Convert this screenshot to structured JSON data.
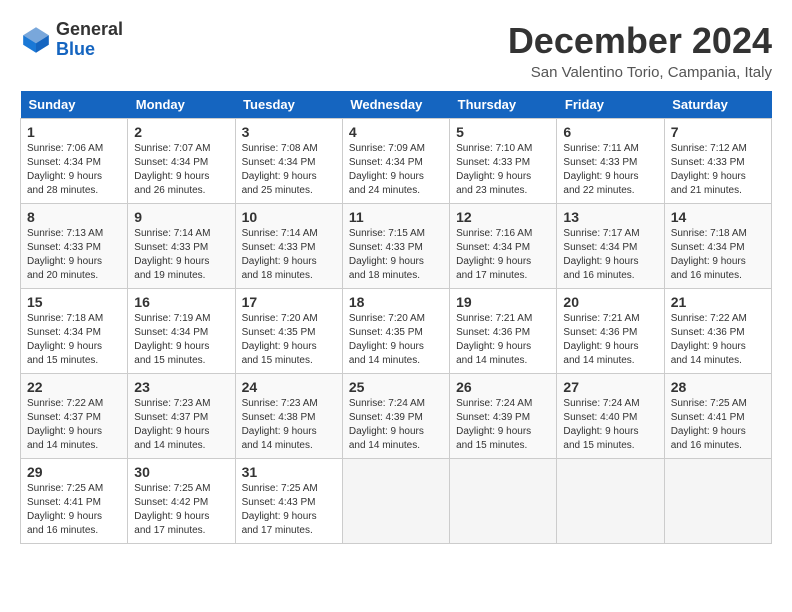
{
  "header": {
    "logo_line1": "General",
    "logo_line2": "Blue",
    "month": "December 2024",
    "location": "San Valentino Torio, Campania, Italy"
  },
  "weekdays": [
    "Sunday",
    "Monday",
    "Tuesday",
    "Wednesday",
    "Thursday",
    "Friday",
    "Saturday"
  ],
  "weeks": [
    [
      {
        "day": "1",
        "sunrise": "7:06 AM",
        "sunset": "4:34 PM",
        "daylight": "9 hours and 28 minutes."
      },
      {
        "day": "2",
        "sunrise": "7:07 AM",
        "sunset": "4:34 PM",
        "daylight": "9 hours and 26 minutes."
      },
      {
        "day": "3",
        "sunrise": "7:08 AM",
        "sunset": "4:34 PM",
        "daylight": "9 hours and 25 minutes."
      },
      {
        "day": "4",
        "sunrise": "7:09 AM",
        "sunset": "4:34 PM",
        "daylight": "9 hours and 24 minutes."
      },
      {
        "day": "5",
        "sunrise": "7:10 AM",
        "sunset": "4:33 PM",
        "daylight": "9 hours and 23 minutes."
      },
      {
        "day": "6",
        "sunrise": "7:11 AM",
        "sunset": "4:33 PM",
        "daylight": "9 hours and 22 minutes."
      },
      {
        "day": "7",
        "sunrise": "7:12 AM",
        "sunset": "4:33 PM",
        "daylight": "9 hours and 21 minutes."
      }
    ],
    [
      {
        "day": "8",
        "sunrise": "7:13 AM",
        "sunset": "4:33 PM",
        "daylight": "9 hours and 20 minutes."
      },
      {
        "day": "9",
        "sunrise": "7:14 AM",
        "sunset": "4:33 PM",
        "daylight": "9 hours and 19 minutes."
      },
      {
        "day": "10",
        "sunrise": "7:14 AM",
        "sunset": "4:33 PM",
        "daylight": "9 hours and 18 minutes."
      },
      {
        "day": "11",
        "sunrise": "7:15 AM",
        "sunset": "4:33 PM",
        "daylight": "9 hours and 18 minutes."
      },
      {
        "day": "12",
        "sunrise": "7:16 AM",
        "sunset": "4:34 PM",
        "daylight": "9 hours and 17 minutes."
      },
      {
        "day": "13",
        "sunrise": "7:17 AM",
        "sunset": "4:34 PM",
        "daylight": "9 hours and 16 minutes."
      },
      {
        "day": "14",
        "sunrise": "7:18 AM",
        "sunset": "4:34 PM",
        "daylight": "9 hours and 16 minutes."
      }
    ],
    [
      {
        "day": "15",
        "sunrise": "7:18 AM",
        "sunset": "4:34 PM",
        "daylight": "9 hours and 15 minutes."
      },
      {
        "day": "16",
        "sunrise": "7:19 AM",
        "sunset": "4:34 PM",
        "daylight": "9 hours and 15 minutes."
      },
      {
        "day": "17",
        "sunrise": "7:20 AM",
        "sunset": "4:35 PM",
        "daylight": "9 hours and 15 minutes."
      },
      {
        "day": "18",
        "sunrise": "7:20 AM",
        "sunset": "4:35 PM",
        "daylight": "9 hours and 14 minutes."
      },
      {
        "day": "19",
        "sunrise": "7:21 AM",
        "sunset": "4:36 PM",
        "daylight": "9 hours and 14 minutes."
      },
      {
        "day": "20",
        "sunrise": "7:21 AM",
        "sunset": "4:36 PM",
        "daylight": "9 hours and 14 minutes."
      },
      {
        "day": "21",
        "sunrise": "7:22 AM",
        "sunset": "4:36 PM",
        "daylight": "9 hours and 14 minutes."
      }
    ],
    [
      {
        "day": "22",
        "sunrise": "7:22 AM",
        "sunset": "4:37 PM",
        "daylight": "9 hours and 14 minutes."
      },
      {
        "day": "23",
        "sunrise": "7:23 AM",
        "sunset": "4:37 PM",
        "daylight": "9 hours and 14 minutes."
      },
      {
        "day": "24",
        "sunrise": "7:23 AM",
        "sunset": "4:38 PM",
        "daylight": "9 hours and 14 minutes."
      },
      {
        "day": "25",
        "sunrise": "7:24 AM",
        "sunset": "4:39 PM",
        "daylight": "9 hours and 14 minutes."
      },
      {
        "day": "26",
        "sunrise": "7:24 AM",
        "sunset": "4:39 PM",
        "daylight": "9 hours and 15 minutes."
      },
      {
        "day": "27",
        "sunrise": "7:24 AM",
        "sunset": "4:40 PM",
        "daylight": "9 hours and 15 minutes."
      },
      {
        "day": "28",
        "sunrise": "7:25 AM",
        "sunset": "4:41 PM",
        "daylight": "9 hours and 16 minutes."
      }
    ],
    [
      {
        "day": "29",
        "sunrise": "7:25 AM",
        "sunset": "4:41 PM",
        "daylight": "9 hours and 16 minutes."
      },
      {
        "day": "30",
        "sunrise": "7:25 AM",
        "sunset": "4:42 PM",
        "daylight": "9 hours and 17 minutes."
      },
      {
        "day": "31",
        "sunrise": "7:25 AM",
        "sunset": "4:43 PM",
        "daylight": "9 hours and 17 minutes."
      },
      null,
      null,
      null,
      null
    ]
  ]
}
